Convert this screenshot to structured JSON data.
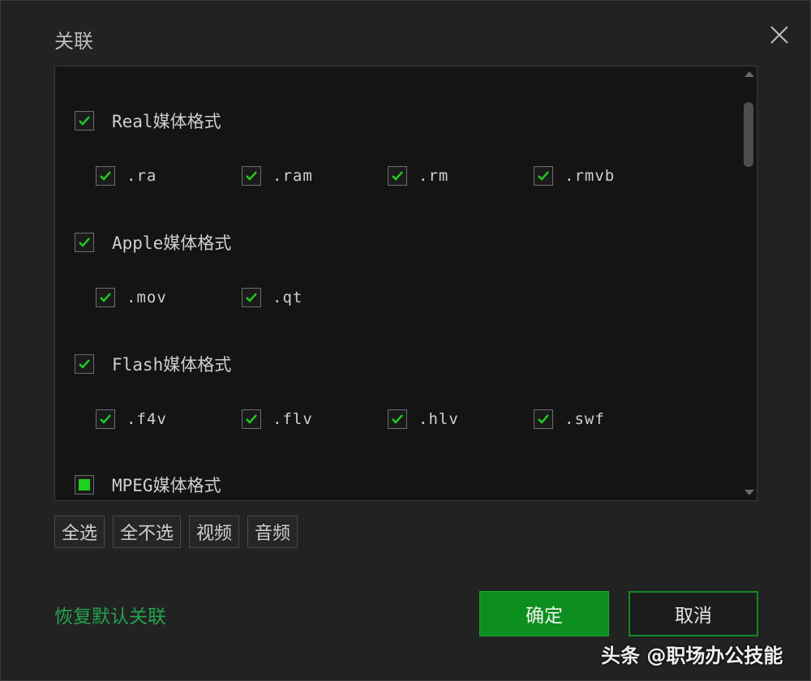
{
  "dialog": {
    "title": "关联",
    "close_icon": "close-icon"
  },
  "groups": [
    {
      "label": "Real媒体格式",
      "state": "checked",
      "items": [
        {
          "label": ".ra",
          "checked": true
        },
        {
          "label": ".ram",
          "checked": true
        },
        {
          "label": ".rm",
          "checked": true
        },
        {
          "label": ".rmvb",
          "checked": true
        }
      ]
    },
    {
      "label": "Apple媒体格式",
      "state": "checked",
      "items": [
        {
          "label": ".mov",
          "checked": true
        },
        {
          "label": ".qt",
          "checked": true
        }
      ]
    },
    {
      "label": "Flash媒体格式",
      "state": "checked",
      "items": [
        {
          "label": ".f4v",
          "checked": true
        },
        {
          "label": ".flv",
          "checked": true
        },
        {
          "label": ".hlv",
          "checked": true
        },
        {
          "label": ".swf",
          "checked": true
        }
      ]
    },
    {
      "label": "MPEG媒体格式",
      "state": "partial",
      "items": []
    }
  ],
  "buttons": {
    "select_all": "全选",
    "select_none": "全不选",
    "video": "视频",
    "audio": "音频",
    "restore_default": "恢复默认关联",
    "ok": "确定",
    "cancel": "取消"
  },
  "watermark": "头条 @职场办公技能",
  "colors": {
    "accent_green": "#1fd11f",
    "ok_button": "#0c8f1e",
    "link_green": "#23a34f",
    "background": "#222222"
  }
}
